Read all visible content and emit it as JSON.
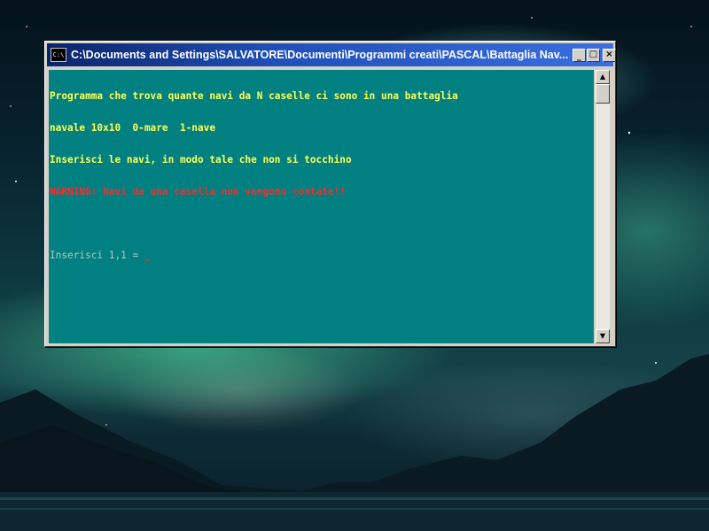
{
  "window": {
    "title": "C:\\Documents and Settings\\SALVATORE\\Documenti\\Programmi creati\\PASCAL\\Battaglia Nav...",
    "icon_text": "C:\\",
    "buttons": {
      "minimize": "_",
      "maximize": "□",
      "close": "×"
    }
  },
  "console": {
    "background_color": "#008080",
    "lines": [
      {
        "text": "Programma che trova quante navi da N caselle ci sono in una battaglia",
        "color": "yellow"
      },
      {
        "text": "navale 10x10  0-mare  1-nave",
        "color": "yellow"
      },
      {
        "text": "Inserisci le navi, in modo tale che non si tocchino",
        "color": "yellow"
      },
      {
        "text": "WARNING: Navi da una casella non vengono contate!!",
        "color": "red"
      },
      {
        "text": "",
        "color": "gray"
      }
    ],
    "prompt": "Inserisci 1,1 = ",
    "cursor": "_"
  },
  "scrollbar": {
    "up_arrow": "▲",
    "down_arrow": "▼"
  },
  "icons": {
    "app": "console-app-icon",
    "minimize": "minimize-icon",
    "maximize": "maximize-icon",
    "close": "close-icon"
  }
}
